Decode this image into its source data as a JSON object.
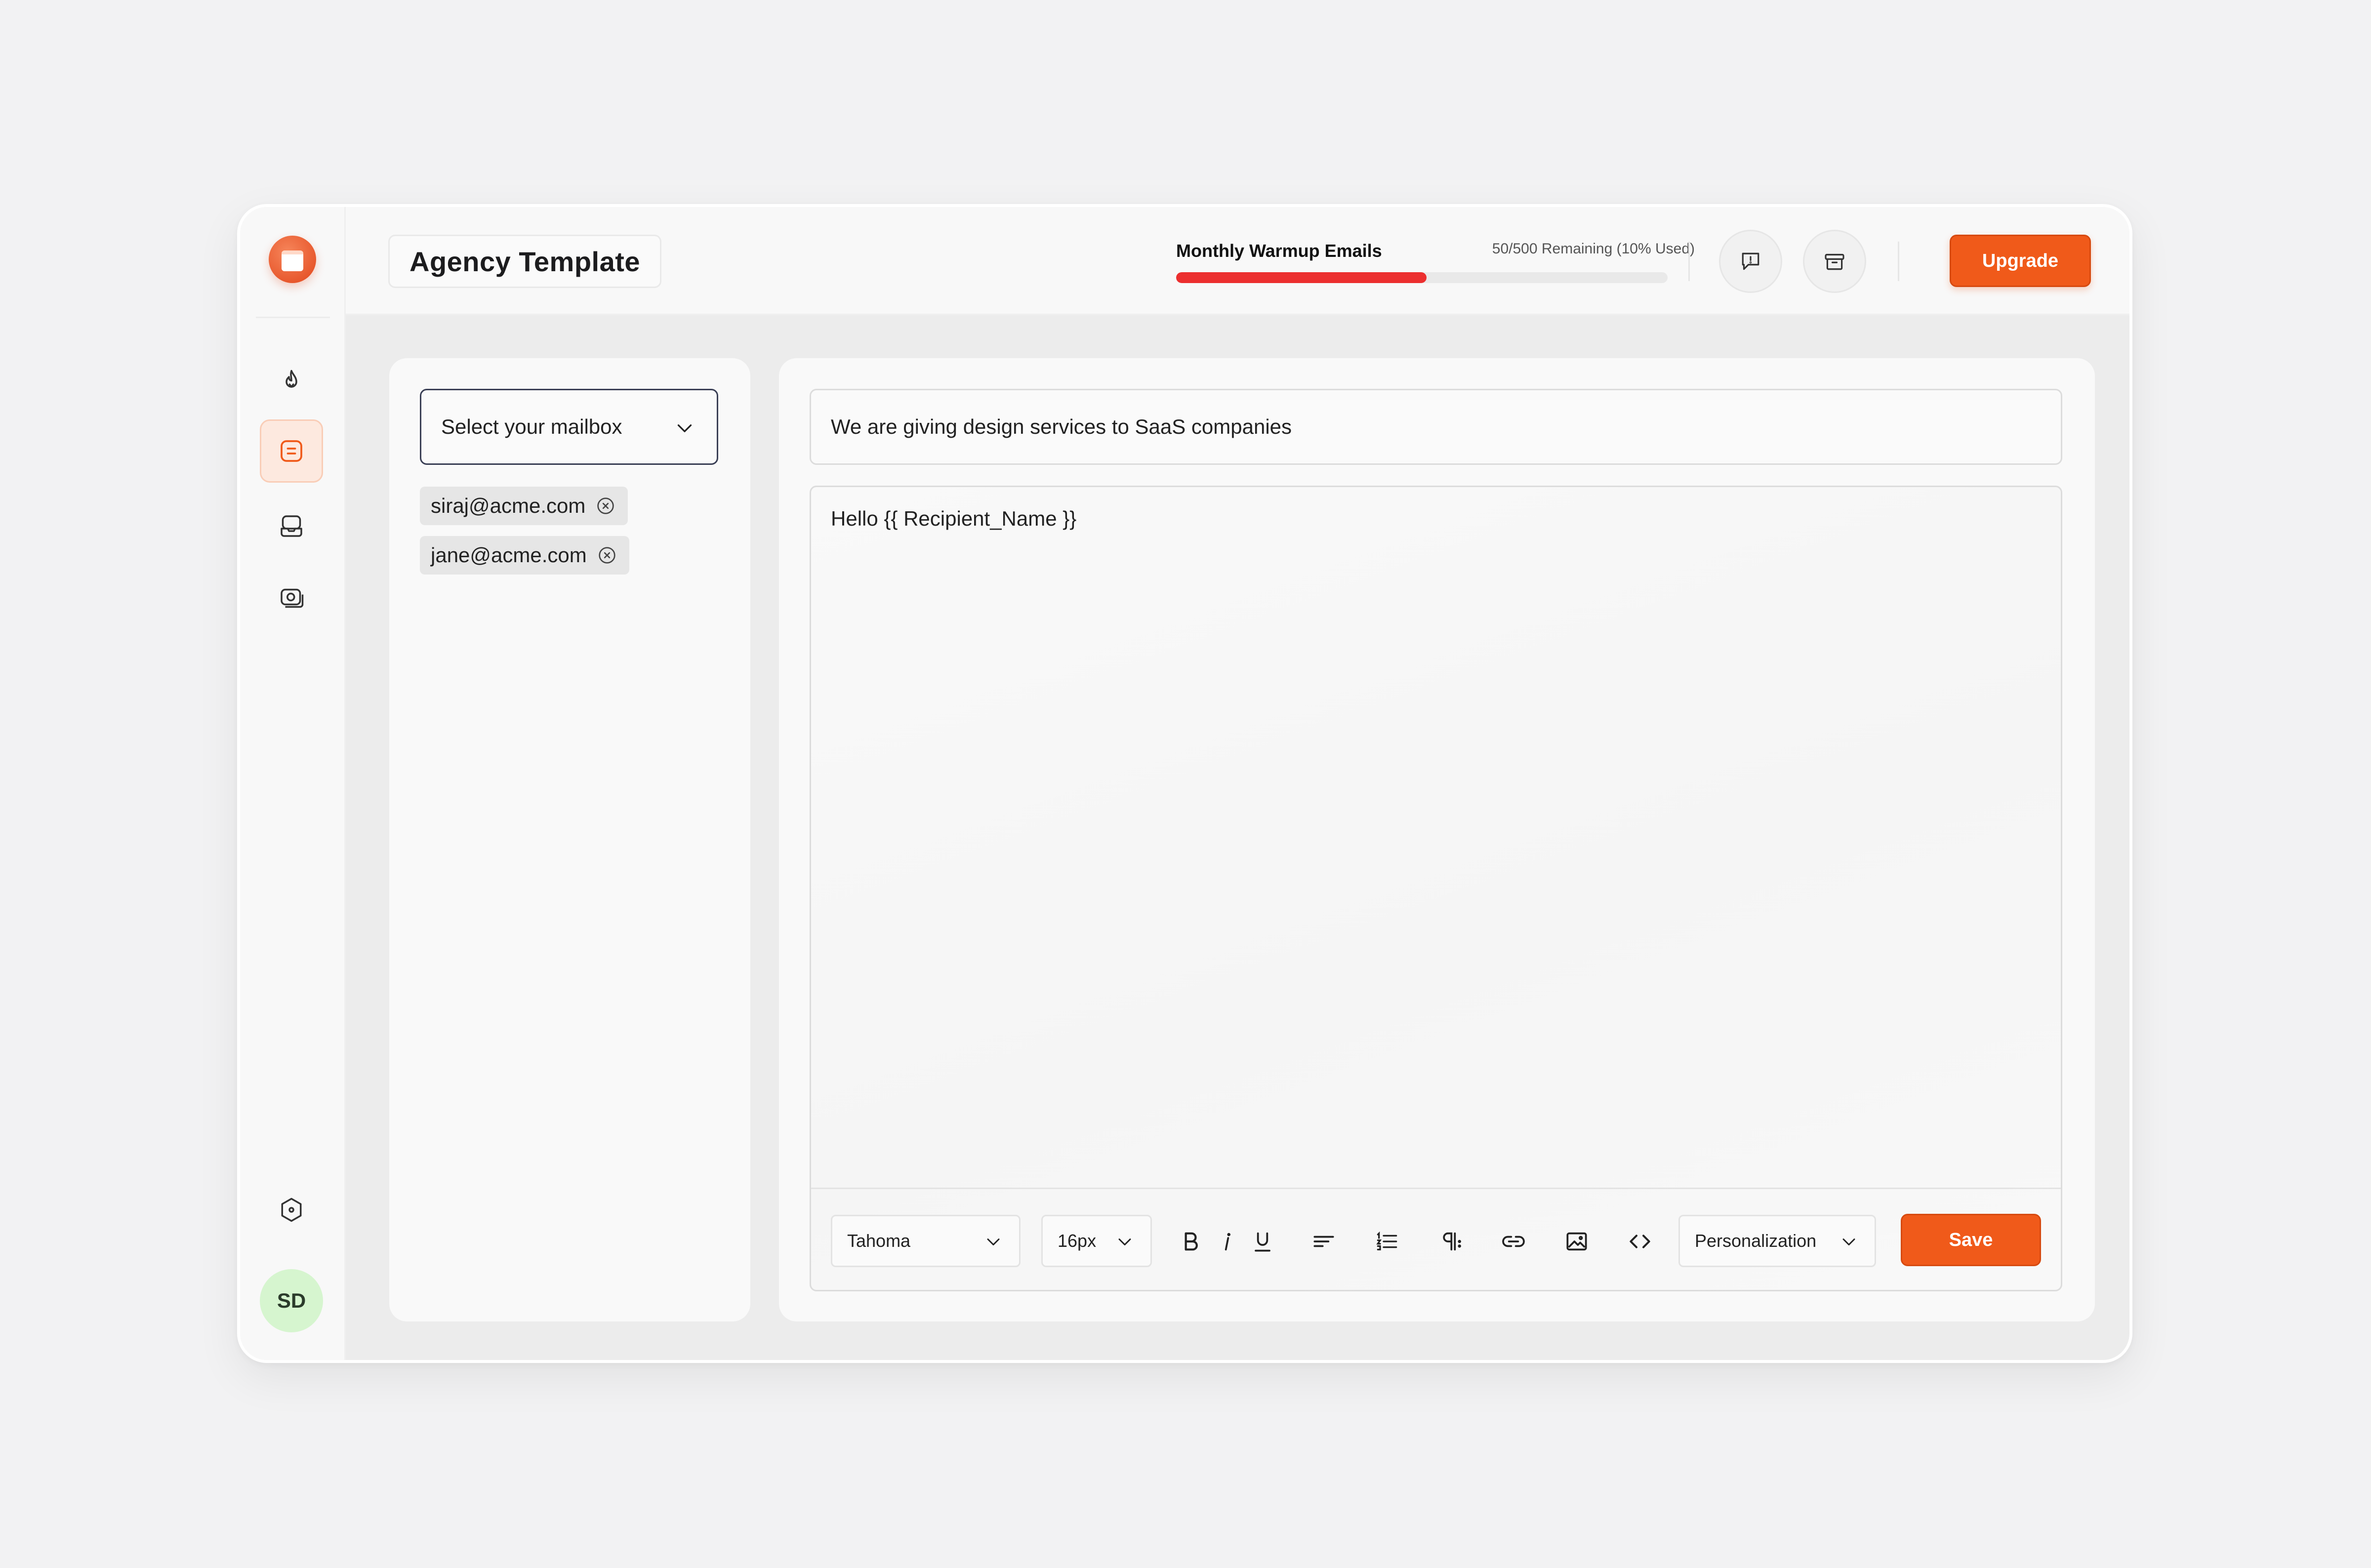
{
  "header": {
    "title": "Agency Template",
    "warmup_label": "Monthly Warmup Emails",
    "warmup_remaining": "50/500 Remaining (10% Used)",
    "warmup_used_fraction": 0.1,
    "upgrade_label": "Upgrade"
  },
  "sidebar": {
    "items": [
      {
        "icon": "flame-icon"
      },
      {
        "icon": "template-icon",
        "active": true
      },
      {
        "icon": "inbox-icon"
      },
      {
        "icon": "camera-icon"
      }
    ],
    "bottom_icon": "hexagon-icon",
    "avatar_initials": "SD"
  },
  "mailbox": {
    "select_label": "Select your mailbox",
    "selected": [
      "siraj@acme.com",
      "jane@acme.com"
    ]
  },
  "editor": {
    "subject": "We are giving design services to SaaS companies",
    "body": "Hello {{ Recipient_Name }}",
    "font": "Tahoma",
    "font_size": "16px",
    "personalization_label": "Personalization",
    "save_label": "Save"
  },
  "colors": {
    "accent": "#f05a1a",
    "progress": "#ec2f2f",
    "avatar_bg": "#d6f5cf"
  }
}
